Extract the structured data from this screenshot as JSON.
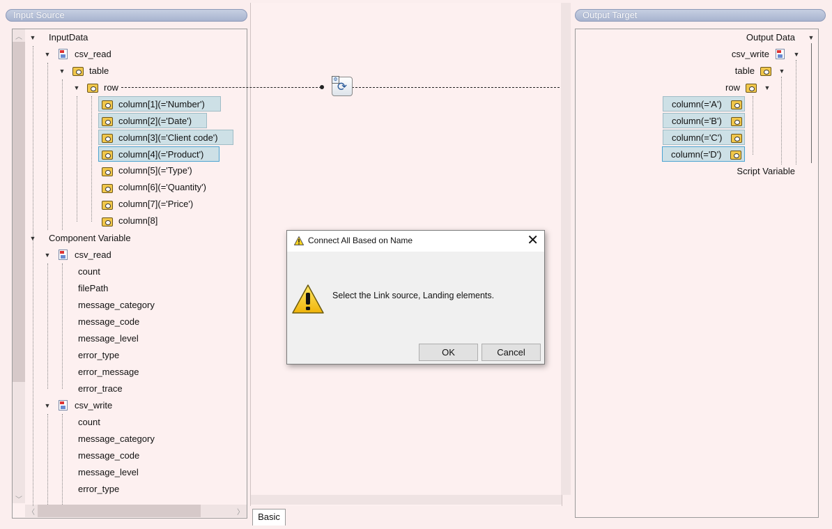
{
  "input_source": {
    "header": "Input Source",
    "input_data_label": "InputData",
    "csv_read_label": "csv_read",
    "table_label": "table",
    "row_label": "row",
    "columns": [
      "column[1](='Number')",
      "column[2](='Date')",
      "column[3](='Client code')",
      "column[4](='Product')",
      "column[5](='Type')",
      "column[6](='Quantity')",
      "column[7](='Price')",
      "column[8]"
    ],
    "component_variable_label": "Component Variable",
    "cv_csv_read_label": "csv_read",
    "cv_csv_read_items": [
      "count",
      "filePath",
      "message_category",
      "message_code",
      "message_level",
      "error_type",
      "error_message",
      "error_trace"
    ],
    "cv_csv_write_label": "csv_write",
    "cv_csv_write_items": [
      "count",
      "message_category",
      "message_code",
      "message_level",
      "error_type"
    ]
  },
  "output_target": {
    "header": "Output Target",
    "output_data_label": "Output Data",
    "csv_write_label": "csv_write",
    "table_label": "table",
    "row_label": "row",
    "columns": [
      "column(='A')",
      "column(='B')",
      "column(='C')",
      "column(='D')"
    ],
    "script_variable_label": "Script Variable"
  },
  "center": {
    "tab_label": "Basic"
  },
  "dialog": {
    "title": "Connect All Based on Name",
    "message": "Select the Link source, Landing elements.",
    "ok_label": "OK",
    "cancel_label": "Cancel",
    "close_glyph": "✕",
    "warning_glyph": "!"
  },
  "icons": {
    "warning": "warning-icon",
    "folder": "folder-icon",
    "file": "csv-file-icon",
    "mapper": "mapping-function-icon"
  },
  "colors": {
    "background": "#fbeeee",
    "header_bar": "#b4bfd8",
    "selected_column": "#cde0e6",
    "selected_border": "#4ba3d1"
  }
}
